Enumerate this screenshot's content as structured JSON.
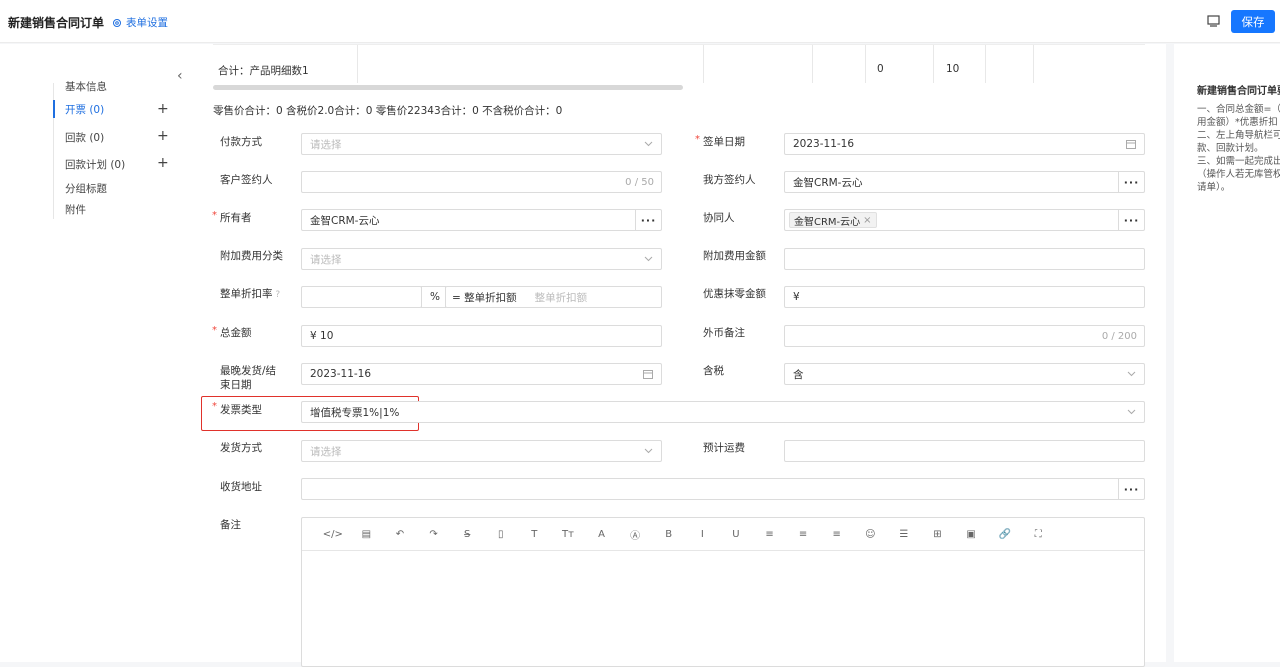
{
  "header": {
    "title": "新建销售合同订单",
    "settings_label": "表单设置",
    "save_label": "保存"
  },
  "leftnav": {
    "items": [
      {
        "label": "基本信息",
        "active": false,
        "plus": false
      },
      {
        "label": "开票  (0)",
        "active": true,
        "plus": true
      },
      {
        "label": "回款  (0)",
        "active": false,
        "plus": true
      },
      {
        "label": "回款计划  (0)",
        "active": false,
        "plus": true
      },
      {
        "label": "分组标题",
        "active": false,
        "plus": false
      },
      {
        "label": "附件",
        "active": false,
        "plus": false
      }
    ]
  },
  "summary": {
    "label": "合计：产品明细数1",
    "val1": "0",
    "val2": "10"
  },
  "totals_text": "零售价合计：0  含税价2.0合计：0  零售价22343合计：0  不含税价合计：0",
  "form": {
    "payment_method": {
      "label": "付款方式",
      "placeholder": "请选择"
    },
    "sign_date": {
      "label": "签单日期",
      "value": "2023-11-16"
    },
    "customer_signer": {
      "label": "客户签约人",
      "counter": "0 / 50"
    },
    "our_signer": {
      "label": "我方签约人",
      "value": "金智CRM-云心"
    },
    "owner": {
      "label": "所有者",
      "value": "金智CRM-云心"
    },
    "collaborator": {
      "label": "协同人",
      "tag": "金智CRM-云心"
    },
    "extra_fee_category": {
      "label": "附加费用分类",
      "placeholder": "请选择"
    },
    "extra_fee_amount": {
      "label": "附加费用金额"
    },
    "discount_rate": {
      "label": "整单折扣率",
      "percent": "%",
      "equals": "= 整单折扣额",
      "placeholder": "整单折扣额"
    },
    "rounding_amount": {
      "label": "优惠抹零金额",
      "value": "¥"
    },
    "total_amount": {
      "label": "总金额",
      "value": "¥ 10"
    },
    "fx_note": {
      "label": "外币备注",
      "counter": "0 / 200"
    },
    "latest_ship": {
      "label_line1": "最晚发货/结",
      "label_line2": "束日期",
      "value": "2023-11-16"
    },
    "tax_included": {
      "label": "含税",
      "value": "含"
    },
    "invoice_type": {
      "label": "发票类型",
      "value": "增值税专票1%|1%"
    },
    "ship_method": {
      "label": "发货方式",
      "placeholder": "请选择"
    },
    "est_freight": {
      "label": "预计运费"
    },
    "ship_address": {
      "label": "收货地址"
    },
    "remark": {
      "label": "备注"
    }
  },
  "editor_tools": [
    "</>",
    "▤",
    "↶",
    "↷",
    "S̶",
    "▯",
    "T",
    "Tт",
    "A",
    "Ⓐ",
    "B",
    "I",
    "U",
    "≡",
    "≡",
    "≡",
    "☺",
    "☰",
    "⊞",
    "▣",
    "🔗",
    "⛶"
  ],
  "right_panel": {
    "title": "新建销售合同订单要",
    "lines": [
      "一、合同总金额=（",
      "用金额）*优惠折扣",
      "二、左上角导航栏可",
      "款、回款计划。",
      "三、如需一起完成出",
      "（操作人若无库管权",
      "请单）。"
    ]
  },
  "colors": {
    "accent": "#1677ff",
    "required": "#f0463c",
    "highlight": "#e0322b"
  }
}
